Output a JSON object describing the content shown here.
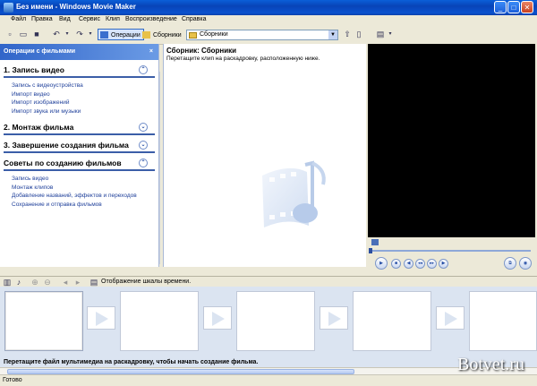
{
  "window": {
    "title": "Без имени - Windows Movie Maker",
    "minimize": "_",
    "maximize": "□",
    "close": "✕"
  },
  "menu": [
    "Файл",
    "Правка",
    "Вид",
    "Сервис",
    "Клип",
    "Воспроизведение",
    "Справка"
  ],
  "toolbar": {
    "operations_label": "Операции",
    "collections_label": "Сборники",
    "collection_select_value": "Сборники"
  },
  "taskpane": {
    "header": "Операции с фильмами",
    "close_glyph": "×",
    "sections": [
      {
        "title": "1. Запись видео",
        "expanded": true,
        "links": [
          "Запись с видеоустройства",
          "Импорт видео",
          "Импорт изображений",
          "Импорт звука или музыки"
        ]
      },
      {
        "title": "2. Монтаж фильма",
        "expanded": false,
        "links": []
      },
      {
        "title": "3. Завершение создания фильма",
        "expanded": false,
        "links": []
      },
      {
        "title": "Советы по созданию фильмов",
        "expanded": true,
        "links": [
          "Запись видео",
          "Монтаж клипов",
          "Добавление названий, эффектов и переходов",
          "Сохранение и отправка фильмов"
        ]
      }
    ]
  },
  "collection": {
    "title": "Сборник: Сборники",
    "subtitle": "Перетащите клип на раскадровку, расположенную ниже."
  },
  "storyboard": {
    "toolbar_label": "Отображение шкалы времени.",
    "hint": "Перетащите файл мультимедиа на раскадровку, чтобы начать создание фильма."
  },
  "status": {
    "text": "Готово"
  },
  "brand": "Botvet.ru",
  "colors": {
    "title_bar": "#0a52cf",
    "task_header": "#3165c9",
    "link": "#1e3f9a",
    "storyboard_bg": "#dbe4f1"
  }
}
